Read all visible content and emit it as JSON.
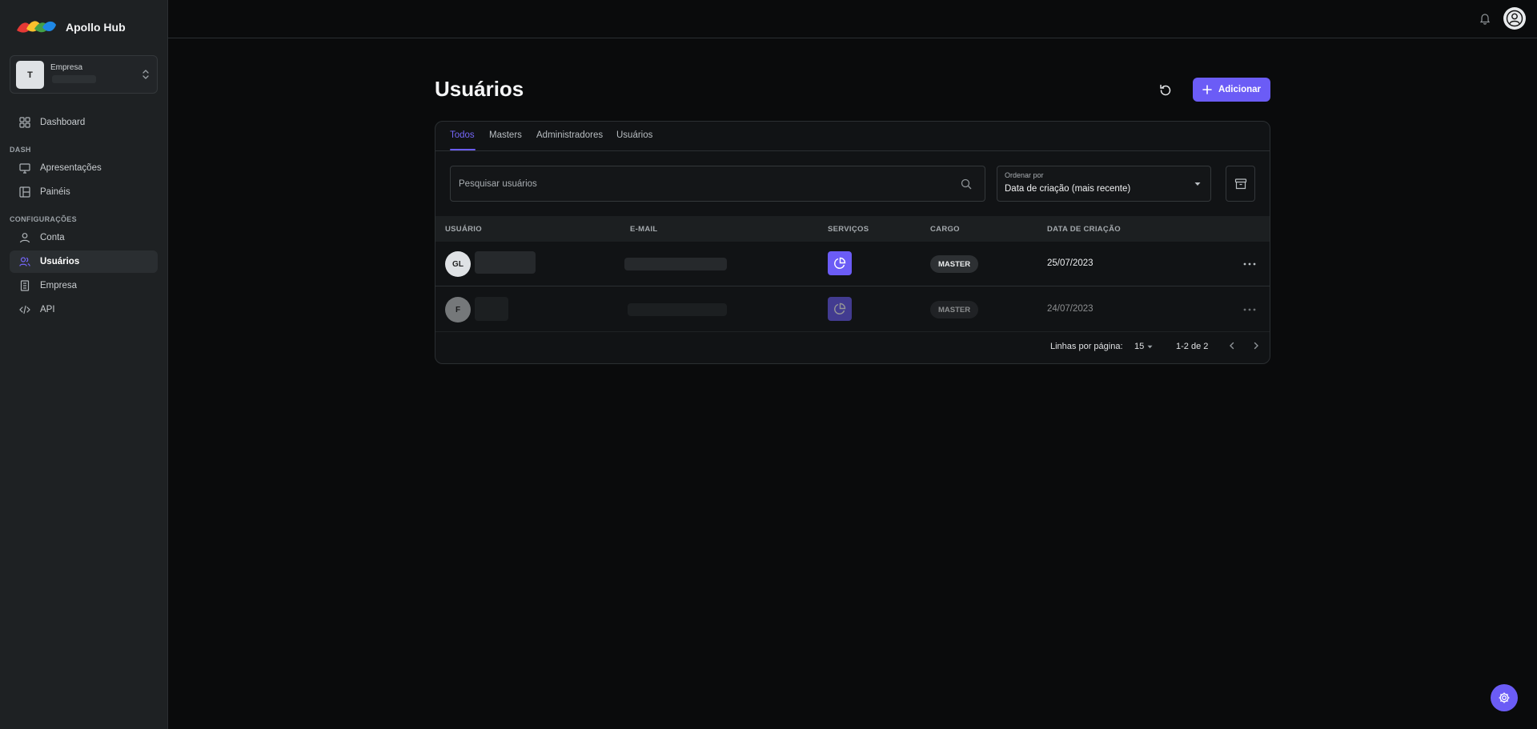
{
  "app": {
    "name": "Apollo Hub"
  },
  "company_selector": {
    "avatar_letter": "T",
    "label": "Empresa"
  },
  "nav": {
    "dashboard": "Dashboard",
    "section_dash": "DASH",
    "apresentacoes": "Apresentações",
    "paineis": "Painéis",
    "section_config": "CONFIGURAÇÕES",
    "conta": "Conta",
    "usuarios": "Usuários",
    "empresa": "Empresa",
    "api": "API"
  },
  "page": {
    "title": "Usuários",
    "add_label": "Adicionar"
  },
  "tabs": [
    "Todos",
    "Masters",
    "Administradores",
    "Usuários"
  ],
  "search": {
    "placeholder": "Pesquisar usuários"
  },
  "sort": {
    "label": "Ordenar por",
    "value": "Data de criação (mais recente)"
  },
  "table": {
    "headers": [
      "USUÁRIO",
      "E-MAIL",
      "SERVIÇOS",
      "CARGO",
      "DATA DE CRIAÇÃO"
    ],
    "rows": [
      {
        "initials": "GL",
        "role": "MASTER",
        "created": "25/07/2023"
      },
      {
        "initials": "F",
        "role": "MASTER",
        "created": "24/07/2023"
      }
    ]
  },
  "pagination": {
    "rows_label": "Linhas por página:",
    "rows_value": "15",
    "range": "1-2 de 2"
  },
  "colors": {
    "accent": "#6b5cf6",
    "background": "#0a0b0c",
    "sidebar": "#1e2123"
  }
}
